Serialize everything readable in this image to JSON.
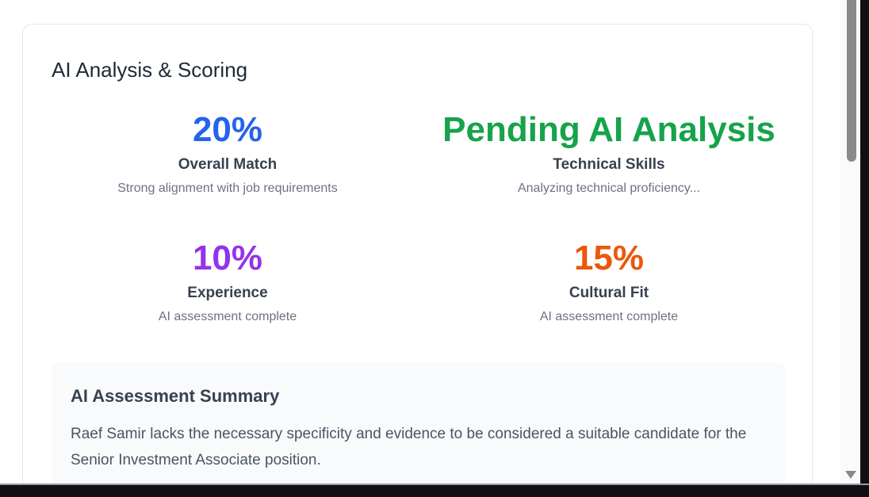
{
  "section": {
    "title": "AI Analysis & Scoring"
  },
  "metrics": [
    {
      "value": "20%",
      "label": "Overall Match",
      "description": "Strong alignment with job requirements",
      "color": "#2563eb"
    },
    {
      "value": "Pending AI Analysis",
      "label": "Technical Skills",
      "description": "Analyzing technical proficiency...",
      "color": "#16a34a"
    },
    {
      "value": "10%",
      "label": "Experience",
      "description": "AI assessment complete",
      "color": "#9333ea"
    },
    {
      "value": "15%",
      "label": "Cultural Fit",
      "description": "AI assessment complete",
      "color": "#ea580c"
    }
  ],
  "summary": {
    "title": "AI Assessment Summary",
    "text": "Raef Samir lacks the necessary specificity and evidence to be considered a suitable candidate for the Senior Investment Associate position."
  }
}
